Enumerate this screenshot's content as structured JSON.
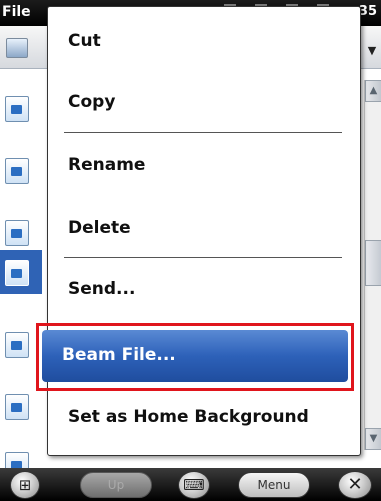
{
  "window": {
    "title": "File",
    "status_time": "35"
  },
  "context_menu": {
    "items": [
      {
        "label": "Cut"
      },
      {
        "label": "Copy"
      },
      {
        "label": "Rename"
      },
      {
        "label": "Delete"
      },
      {
        "label": "Send..."
      },
      {
        "label": "Beam File...",
        "highlighted": true
      },
      {
        "label": "Set as Home Background"
      }
    ]
  },
  "softkeys": {
    "start_icon": "windows-logo-icon",
    "up_label": "Up",
    "keyboard_icon": "keyboard-icon",
    "menu_label": "Menu",
    "close_icon": "close-icon"
  },
  "colors": {
    "highlight": "#2d61b9",
    "callout_border": "#e0151c"
  }
}
